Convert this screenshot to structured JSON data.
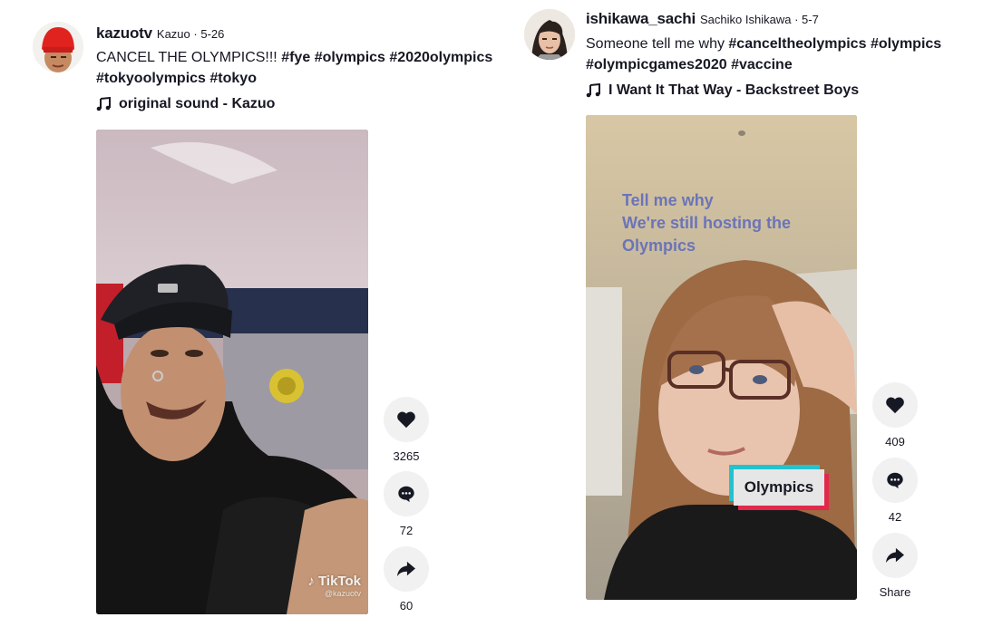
{
  "post1": {
    "username": "kazuotv",
    "nickname": "Kazuo",
    "separator": " · ",
    "date": "5-26",
    "caption_text": "CANCEL THE OLYMPICS!!! ",
    "hashtags": [
      "#fye",
      "#olympics",
      "#2020olympics",
      "#tokyoolympics",
      "#tokyo"
    ],
    "music": "original sound - Kazuo",
    "watermark": "TikTok",
    "watermark_handle": "@kazuotv",
    "likes": "3265",
    "comments": "72",
    "shares": "60"
  },
  "post2": {
    "username": "ishikawa_sachi",
    "nickname": "Sachiko Ishikawa",
    "separator": " · ",
    "date": "5-7",
    "caption_text": "Someone tell me why ",
    "hashtags": [
      "#canceltheolympics",
      "#olympics",
      "#olympicgames2020",
      "#vaccine"
    ],
    "music": "I Want It That Way - Backstreet Boys",
    "overlay_lines": [
      "Tell me why",
      "We're still hosting the",
      "Olympics"
    ],
    "sticker": "Olympics",
    "likes": "409",
    "comments": "42",
    "share_label": "Share"
  },
  "icons": {
    "heart": "heart-icon",
    "comment": "comment-icon",
    "share": "share-icon",
    "music": "music-note-icon",
    "tiktok": "tiktok-logo-icon"
  },
  "colors": {
    "text": "#161823",
    "action_bg": "#f1f1f2",
    "overlay_text": "#6b74b8",
    "cyan": "#22c3cf",
    "red": "#e3284b"
  }
}
